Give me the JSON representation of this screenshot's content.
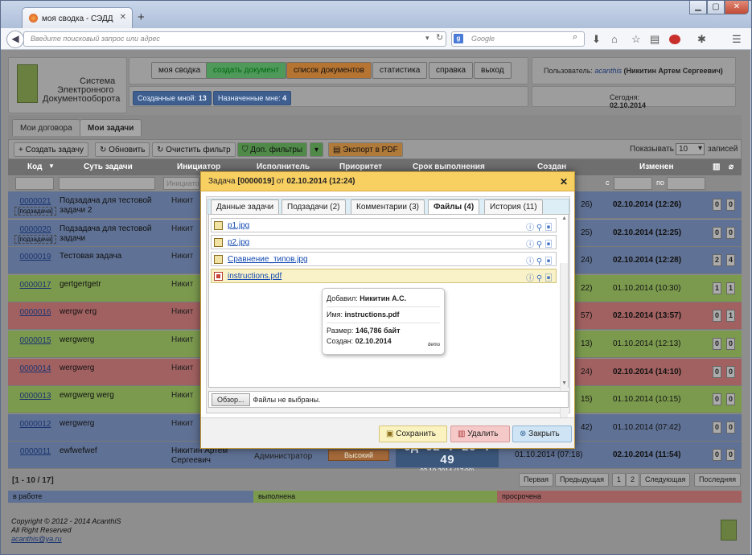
{
  "browser": {
    "tab_title": "моя сводка - СЭДД",
    "new_tab": "+",
    "url_placeholder": "Введите поисковый запрос или адрес",
    "search_placeholder": "Google",
    "search_badge": "g",
    "win_min": "▁",
    "win_max": "▢",
    "win_close": "✕"
  },
  "app": {
    "logo": {
      "line1": "Система",
      "line2": "Электронного",
      "line3": "Документооборота"
    },
    "menu": [
      "моя сводка",
      "создать документ",
      "список документов",
      "статистика",
      "справка",
      "выход"
    ],
    "counters": [
      {
        "label": "Созданные мной:",
        "value": "13"
      },
      {
        "label": "Назначенные мне:",
        "value": "4"
      }
    ],
    "user_prefix": "Пользователь:",
    "user_login": "acanthis",
    "user_name": "(Никитин Артем Сергеевич)",
    "today_label": "Сегодня:",
    "today_value": "02.10.2014",
    "page_tabs": [
      "Мои договора",
      "Мои задачи"
    ],
    "toolbar": {
      "create": "Создать задачу",
      "refresh": "Обновить",
      "clear": "Очистить фильтр",
      "filters": "Доп. фильтры",
      "export": "Экспорт в PDF",
      "show_label": "Показывать",
      "show_value": "10",
      "records": "записей"
    },
    "columns": {
      "code": "Код",
      "essence": "Суть задачи",
      "initiator": "Инициатор",
      "executor": "Исполнитель",
      "priority": "Приоритет",
      "deadline": "Срок выполнения",
      "created": "Создан",
      "changed": "Изменен"
    },
    "filter": {
      "initiator_placeholder": "Инициато",
      "from": "с",
      "to": "по"
    },
    "rows": [
      {
        "code": "0000021",
        "sub": "[подзадача]",
        "task": "Подзадача для тестовой задачи 2",
        "init": "Никити Серге",
        "cr": "26)",
        "edit": "02.10.2014 (12:26)",
        "c1": "0",
        "c2": "0",
        "color": "#5f7194"
      },
      {
        "code": "0000020",
        "sub": "[подзадача]",
        "task": "Подзадача для тестовой задачи",
        "init": "Никити Серге",
        "cr": "25)",
        "edit": "02.10.2014 (12:25)",
        "c1": "0",
        "c2": "0",
        "color": "#5f7194"
      },
      {
        "code": "0000019",
        "sub": "",
        "task": "Тестовая задача",
        "init": "Никити Серге",
        "cr": "24)",
        "edit": "02.10.2014 (12:28)",
        "c1": "2",
        "c2": "4",
        "color": "#5f7194"
      },
      {
        "code": "0000017",
        "sub": "",
        "task": "gertgertgetr",
        "init": "Никити Серге",
        "cr": "22)",
        "edit": "01.10.2014 (10:30)",
        "c1": "1",
        "c2": "1",
        "color": "#7b9a4e"
      },
      {
        "code": "0000016",
        "sub": "",
        "task": "wergw erg",
        "init": "Никити Серге",
        "cr": "57)",
        "edit": "02.10.2014 (13:57)",
        "c1": "0",
        "c2": "1",
        "color": "#a26161"
      },
      {
        "code": "0000015",
        "sub": "",
        "task": "wergwerg",
        "init": "Никити Серге",
        "cr": "13)",
        "edit": "01.10.2014 (12:13)",
        "c1": "0",
        "c2": "0",
        "color": "#7b9a4e"
      },
      {
        "code": "0000014",
        "sub": "",
        "task": "wergwerg",
        "init": "Никити Серге",
        "cr": "24)",
        "edit": "02.10.2014 (14:10)",
        "c1": "0",
        "c2": "0",
        "color": "#a26161"
      },
      {
        "code": "0000013",
        "sub": "",
        "task": "ewrgwerg werg",
        "init": "Никити Серге",
        "cr": "15)",
        "edit": "01.10.2014 (10:15)",
        "c1": "0",
        "c2": "0",
        "color": "#7b9a4e"
      },
      {
        "code": "0000012",
        "sub": "",
        "task": "wergwerg",
        "init": "Никити Серге",
        "cr": "42)",
        "edit": "01.10.2014 (07:42)",
        "c1": "0",
        "c2": "0",
        "color": "#5f7194"
      },
      {
        "code": "0000011",
        "sub": "",
        "task": "ewfwefwef",
        "init": "Никитин Артем Сергеевич",
        "cr": "01.10.2014 (07:18)",
        "edit": "02.10.2014 (11:54)",
        "c1": "0",
        "c2": "0",
        "color": "#5f7194",
        "executor": "Администратор",
        "priority": "Высокий",
        "timer": "0д 02 : 29 : 49",
        "timer_date": "02.10.2014 (17:00)"
      }
    ],
    "pager": {
      "range": "[1 - 10 / 17]",
      "first": "Первая",
      "prev": "Предыдущая",
      "p1": "1",
      "p2": "2",
      "next": "Следующая",
      "last": "Последняя"
    },
    "legend": {
      "work": "в работе",
      "done": "выполнена",
      "overdue": "просрочена"
    },
    "footer": {
      "l1": "Copyright © 2012 - 2014 AcanthiS",
      "l2": "All Right Reserved",
      "l3": "acanthis@ya.ru"
    }
  },
  "modal": {
    "title_prefix": "Задача",
    "title_code": "[0000019]",
    "title_from": "от",
    "title_date": "02.10.2014 (12:24)",
    "tabs": [
      {
        "label": "Данные задачи"
      },
      {
        "label": "Подзадачи",
        "count": "(2)"
      },
      {
        "label": "Комментарии",
        "count": "(3)"
      },
      {
        "label": "Файлы",
        "count": "(4)"
      },
      {
        "label": "История",
        "count": "(11)"
      }
    ],
    "files": [
      "p1.jpg",
      "p2.jpg",
      "Сравнение_типов.jpg",
      "instructions.pdf"
    ],
    "tooltip": {
      "added_label": "Добавил:",
      "added": "Никитин А.С.",
      "name_label": "Имя:",
      "name": "instructions.pdf",
      "size_label": "Размер:",
      "size": "146,786 байт",
      "created_label": "Создан:",
      "created": "02.10.2014",
      "tag": "demo"
    },
    "upload": {
      "browse": "Обзор...",
      "status": "Файлы не выбраны."
    },
    "buttons": {
      "save": "Сохранить",
      "delete": "Удалить",
      "close": "Закрыть"
    }
  }
}
